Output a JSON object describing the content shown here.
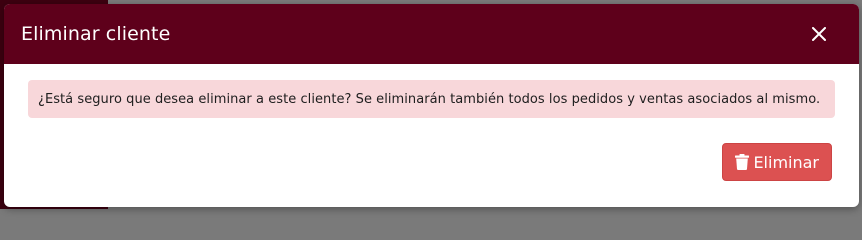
{
  "modal": {
    "title": "Eliminar cliente",
    "message": "¿Está seguro que desea eliminar a este cliente? Se eliminarán también todos los pedidos y ventas asociados al mismo.",
    "delete_label": "Eliminar"
  },
  "colors": {
    "header": "#5e001b",
    "alert_bg": "#f8d7da",
    "danger_button": "#dc5151"
  },
  "icons": {
    "close": "close-icon",
    "trash": "trash-icon"
  }
}
